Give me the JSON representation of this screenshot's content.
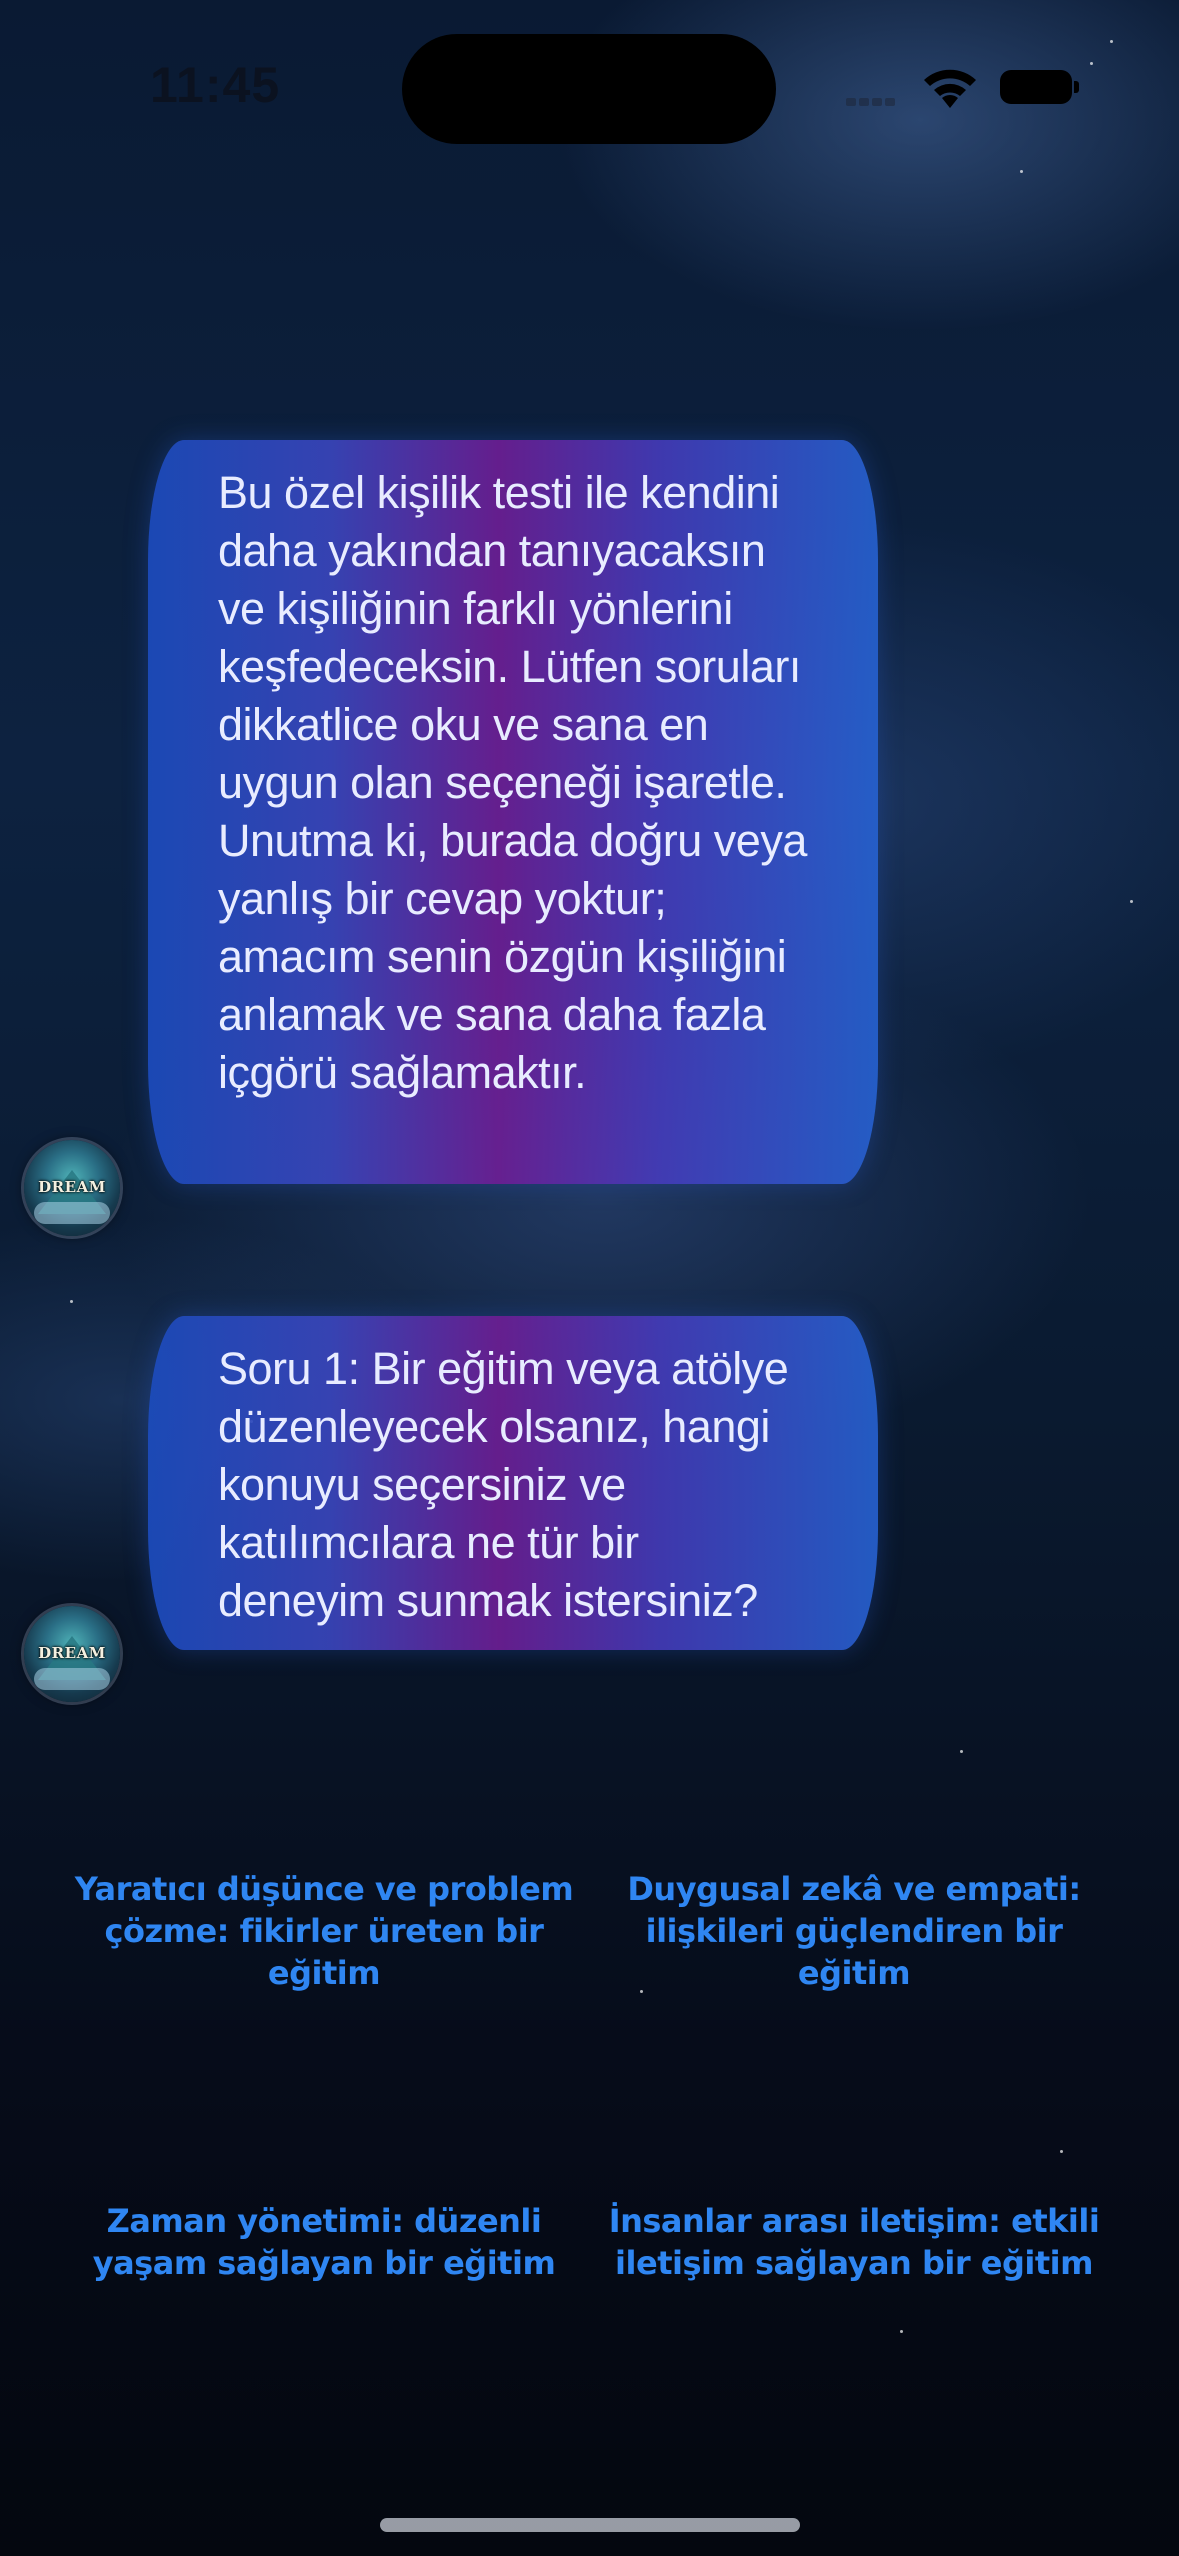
{
  "status_bar": {
    "time": "11:45",
    "icons": [
      "signal-icon",
      "wifi-icon",
      "battery-icon"
    ]
  },
  "chat": {
    "messages": [
      {
        "sender_avatar": "DREAM",
        "text": "Bu özel kişilik testi ile kendini daha yakından tanıyacaksın ve kişiliğinin farklı yönlerini keşfedeceksin. Lütfen soruları dikkatlice oku ve sana en uygun olan seçeneği işaretle. Unutma ki, burada doğru veya yanlış bir cevap yoktur; amacım senin özgün kişiliğini anlamak ve sana daha fazla içgörü sağlamaktır."
      },
      {
        "sender_avatar": "DREAM",
        "text": "Soru 1: Bir eğitim veya atölye düzenleyecek olsanız, hangi konuyu seçersiniz ve katılımcılara ne tür bir deneyim sunmak istersiniz?"
      }
    ]
  },
  "options": [
    "Yaratıcı düşünce ve problem çözme: fikirler üreten bir eğitim",
    "Duygusal zekâ ve empati: ilişkileri güçlendiren bir eğitim",
    "Zaman yönetimi: düzenli yaşam sağlayan bir eğitim",
    "İnsanlar arası iletişim: etkili iletişim sağlayan bir eğitim"
  ],
  "colors": {
    "option_text": "#2f86f2",
    "bubble_gradient_start": "#1c4cbe",
    "bubble_gradient_mid": "#6e1e96",
    "bubble_text": "#e8ecff",
    "background": "#0a1a33"
  }
}
